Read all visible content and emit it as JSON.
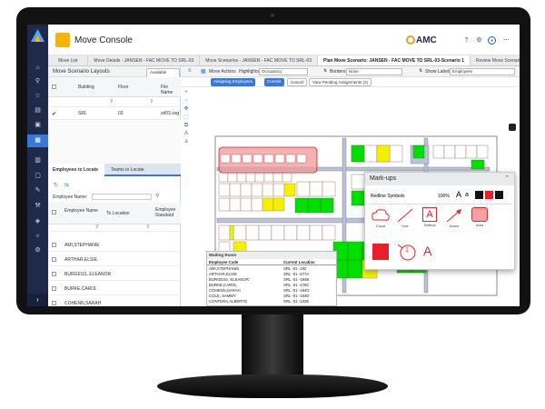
{
  "header": {
    "title": "Move Console",
    "brand": "AMC"
  },
  "tabs": [
    "Move List",
    "Move Details - JANSEN - FAC MOVE TO SRL-03",
    "Move Scenarios - JANSEN - FAC MOVE TO SRL-03",
    "Plan Move Scenario: JANSEN - FAC MOVE TO SRL-03-Scenario 1",
    "Review Move Scenario"
  ],
  "left_panel": {
    "title": "Move Scenario Layouts",
    "available_btn": "Available Layouts",
    "cols": [
      "Building",
      "Floor",
      "File Name"
    ],
    "row": {
      "building": "SRL",
      "floor": "03",
      "file": "srl03.svg"
    },
    "subtabs": [
      "Employees to Locate",
      "Teams to Locate"
    ],
    "filter_label": "Employee Name:",
    "emp_cols": [
      "Employee Name",
      "To Location",
      "Employee Standard"
    ],
    "employees": [
      "AMI,STEPHANIE",
      "ARTHAR,ELSIE",
      "BURGESS, ELEANOR",
      "BURKE,CAROL",
      "COHENN,SARAH"
    ]
  },
  "toolbar": {
    "move_actions": "Move Actions",
    "highlights_label": "Highlights:",
    "highlights_value": "Occupancy",
    "borders_label": "Borders:",
    "borders_value": "None",
    "show_labels_label": "Show Labels:",
    "show_labels_value": "Employees",
    "assigning": "Assigning Employees",
    "commit": "Commit",
    "cancel": "Cancel",
    "view_pending": "View Pending Assignments (2)"
  },
  "waiting_room": {
    "title": "Waiting Room",
    "cols": [
      "Employee Code",
      "Current Location"
    ],
    "rows": [
      [
        "AMI,STEPHANIE",
        "SRL -01 -182"
      ],
      [
        "ARTHAR,ELSIE",
        "SRL -01 -177A"
      ],
      [
        "BURGESS, ELEANOR",
        "SRL -01 -184B"
      ],
      [
        "BURKE,CAROL",
        "SRL -01 -176C"
      ],
      [
        "COHENN,SARAH",
        "SRL -01 -184G"
      ],
      [
        "COLE, SAMMY",
        "SRL -01 -184D"
      ],
      [
        "CONTERA,ALBERTO",
        "SRL -01 -132E"
      ]
    ]
  },
  "markups": {
    "title": "Mark-ups",
    "symbols_label": "Redline Symbols",
    "zoom": "100%",
    "font_a_big": "A",
    "font_a_small": "a",
    "tools": [
      "Cloud",
      "Line",
      "Textbox",
      "Arrow",
      "Area"
    ],
    "textbox_letter": "A",
    "red": "#e8202a",
    "num": "1"
  },
  "colors": {
    "rail": "#1f2a4b",
    "accent": "#3a78d6",
    "green": "#00e000",
    "yellow": "#f5f000"
  }
}
